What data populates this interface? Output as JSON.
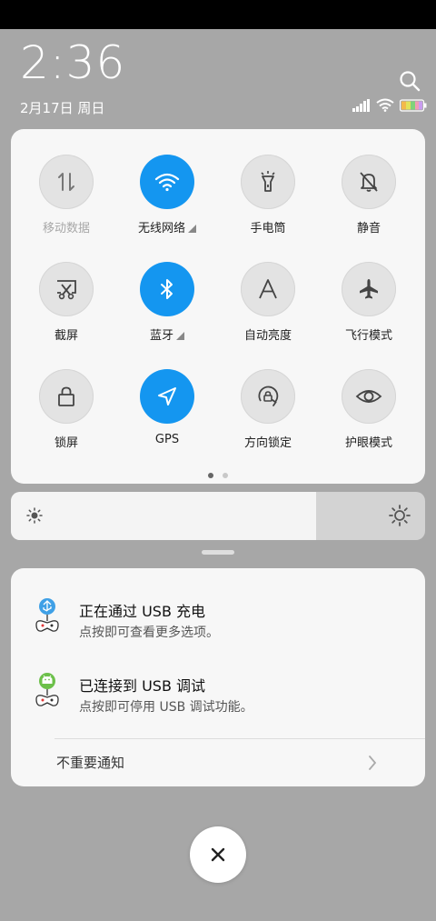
{
  "status": {
    "time": "2:36",
    "date": "2月17日 周日"
  },
  "tiles": [
    {
      "label": "移动数据",
      "icon": "mobile-data-icon",
      "on": false,
      "dim": true,
      "arrow": false
    },
    {
      "label": "无线网络",
      "icon": "wifi-icon",
      "on": true,
      "dim": false,
      "arrow": true
    },
    {
      "label": "手电筒",
      "icon": "flashlight-icon",
      "on": false,
      "dim": false,
      "arrow": false
    },
    {
      "label": "静音",
      "icon": "mute-bell-icon",
      "on": false,
      "dim": false,
      "arrow": false
    },
    {
      "label": "截屏",
      "icon": "screenshot-icon",
      "on": false,
      "dim": false,
      "arrow": false
    },
    {
      "label": "蓝牙",
      "icon": "bluetooth-icon",
      "on": true,
      "dim": false,
      "arrow": true
    },
    {
      "label": "自动亮度",
      "icon": "auto-brightness-icon",
      "on": false,
      "dim": false,
      "arrow": false
    },
    {
      "label": "飞行模式",
      "icon": "airplane-icon",
      "on": false,
      "dim": false,
      "arrow": false
    },
    {
      "label": "锁屏",
      "icon": "lock-icon",
      "on": false,
      "dim": false,
      "arrow": false
    },
    {
      "label": "GPS",
      "icon": "gps-icon",
      "on": true,
      "dim": false,
      "arrow": false
    },
    {
      "label": "方向锁定",
      "icon": "rotation-lock-icon",
      "on": false,
      "dim": false,
      "arrow": false
    },
    {
      "label": "护眼模式",
      "icon": "eye-icon",
      "on": false,
      "dim": false,
      "arrow": false
    }
  ],
  "pager": {
    "pages": 2,
    "active": 0
  },
  "brightness": {
    "level": 0.737
  },
  "notifications": [
    {
      "title": "正在通过 USB 充电",
      "subtitle": "点按即可查看更多选项。",
      "icon": "usb-charging-icon"
    },
    {
      "title": "已连接到 USB 调试",
      "subtitle": "点按即可停用 USB 调试功能。",
      "icon": "usb-debug-icon"
    }
  ],
  "unimportant_label": "不重要通知",
  "colors": {
    "accent": "#1496f0",
    "background": "#a7a7a7",
    "panel": "#f7f7f7"
  }
}
